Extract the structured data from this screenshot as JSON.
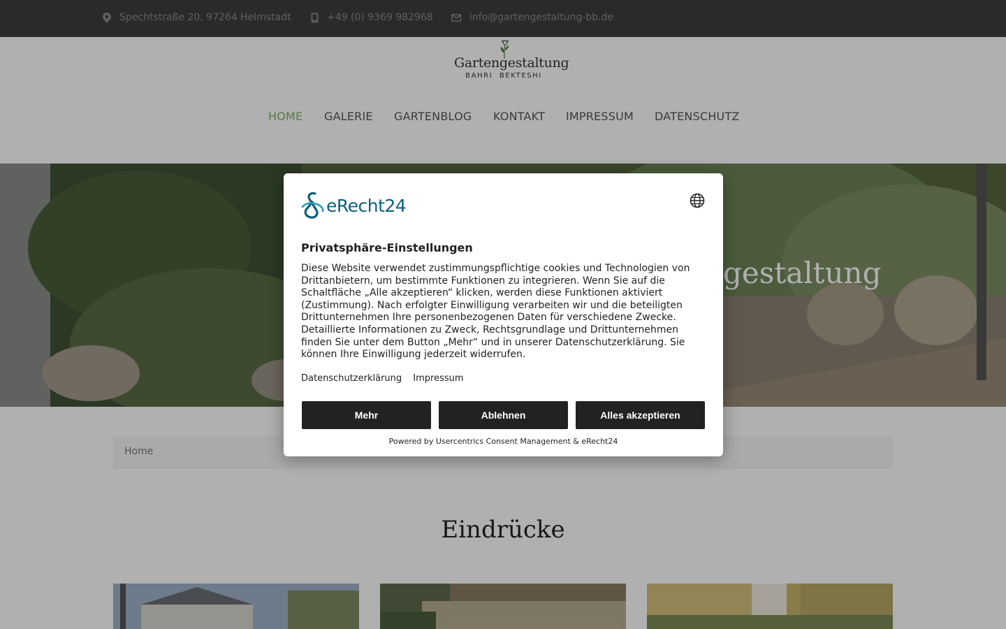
{
  "topbar": {
    "address": "Spechtstraße 20, 97264 Helmstadt",
    "phone": "+49 (0) 9369 982968",
    "email": "info@gartengestaltung-bb.de",
    "address_icon": "map-pin-icon",
    "phone_icon": "mobile-phone-icon",
    "email_icon": "envelope-icon"
  },
  "logo": {
    "name": "Gartengestaltung",
    "sub_left": "BAHRI",
    "sub_right": "BEKTESHI"
  },
  "nav": {
    "items": [
      {
        "label": "HOME",
        "active": true
      },
      {
        "label": "GALERIE",
        "active": false
      },
      {
        "label": "GARTENBLOG",
        "active": false
      },
      {
        "label": "KONTAKT",
        "active": false
      },
      {
        "label": "IMPRESSUM",
        "active": false
      },
      {
        "label": "DATENSCHUTZ",
        "active": false
      }
    ],
    "active_color": "#7bb661"
  },
  "hero": {
    "title_fragment": "gestaltung"
  },
  "breadcrumb": {
    "home": "Home"
  },
  "section": {
    "title": "Eindrücke"
  },
  "consent": {
    "brand": "eRecht24",
    "language_icon": "globe-icon",
    "heading": "Privatsphäre-Einstellungen",
    "description": "Diese Website verwendet zustimmungspflichtige cookies und Technologien von Drittanbietern, um bestimmte Funktionen zu integrieren. Wenn Sie auf die Schaltfläche „Alle akzeptieren“ klicken, werden diese Funktionen aktiviert (Zustimmung). Nach erfolgter Einwilligung verarbeiten wir und die beteiligten Drittunternehmen Ihre personenbezogenen Daten für verschiedene Zwecke. Detaillierte Informationen zu Zweck, Rechtsgrundlage und Drittunternehmen finden Sie unter dem Button „Mehr“ und in unserer Datenschutzerklärung. Sie können Ihre Einwilligung jederzeit widerrufen.",
    "link_privacy": "Datenschutzerklärung",
    "link_imprint": "Impressum",
    "btn_more": "Mehr",
    "btn_decline": "Ablehnen",
    "btn_accept": "Alles akzeptieren",
    "powered_by": "Powered by Usercentrics Consent Management & eRecht24",
    "button_color": "#222222",
    "brand_color": "#0d5f79"
  }
}
